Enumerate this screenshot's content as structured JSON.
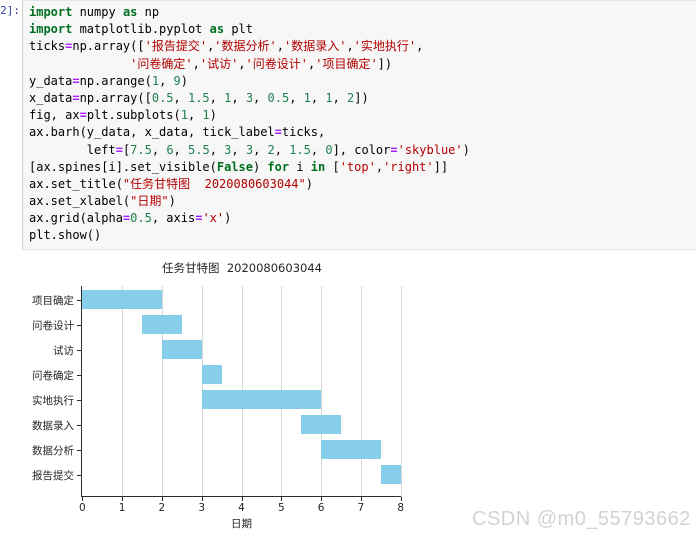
{
  "cell": {
    "prompt": "2]:",
    "code_lines": [
      [
        {
          "t": "import",
          "c": "kw"
        },
        {
          "t": " numpy ",
          "c": "plain"
        },
        {
          "t": "as",
          "c": "kw"
        },
        {
          "t": " np",
          "c": "plain"
        }
      ],
      [
        {
          "t": "import",
          "c": "kw"
        },
        {
          "t": " matplotlib.pyplot ",
          "c": "plain"
        },
        {
          "t": "as",
          "c": "kw"
        },
        {
          "t": " plt",
          "c": "plain"
        }
      ],
      [
        {
          "t": "ticks",
          "c": "plain"
        },
        {
          "t": "=",
          "c": "op"
        },
        {
          "t": "np.array([",
          "c": "plain"
        },
        {
          "t": "'报告提交'",
          "c": "str"
        },
        {
          "t": ",",
          "c": "plain"
        },
        {
          "t": "'数据分析'",
          "c": "str"
        },
        {
          "t": ",",
          "c": "plain"
        },
        {
          "t": "'数据录入'",
          "c": "str"
        },
        {
          "t": ",",
          "c": "plain"
        },
        {
          "t": "'实地执行'",
          "c": "str"
        },
        {
          "t": ",",
          "c": "plain"
        }
      ],
      [
        {
          "t": "              ",
          "c": "plain"
        },
        {
          "t": "'问卷确定'",
          "c": "str"
        },
        {
          "t": ",",
          "c": "plain"
        },
        {
          "t": "'试访'",
          "c": "str"
        },
        {
          "t": ",",
          "c": "plain"
        },
        {
          "t": "'问卷设计'",
          "c": "str"
        },
        {
          "t": ",",
          "c": "plain"
        },
        {
          "t": "'项目确定'",
          "c": "str"
        },
        {
          "t": "])",
          "c": "plain"
        }
      ],
      [
        {
          "t": "y_data",
          "c": "plain"
        },
        {
          "t": "=",
          "c": "op"
        },
        {
          "t": "np.arange(",
          "c": "plain"
        },
        {
          "t": "1",
          "c": "num"
        },
        {
          "t": ", ",
          "c": "plain"
        },
        {
          "t": "9",
          "c": "num"
        },
        {
          "t": ")",
          "c": "plain"
        }
      ],
      [
        {
          "t": "x_data",
          "c": "plain"
        },
        {
          "t": "=",
          "c": "op"
        },
        {
          "t": "np.array([",
          "c": "plain"
        },
        {
          "t": "0.5",
          "c": "num"
        },
        {
          "t": ", ",
          "c": "plain"
        },
        {
          "t": "1.5",
          "c": "num"
        },
        {
          "t": ", ",
          "c": "plain"
        },
        {
          "t": "1",
          "c": "num"
        },
        {
          "t": ", ",
          "c": "plain"
        },
        {
          "t": "3",
          "c": "num"
        },
        {
          "t": ", ",
          "c": "plain"
        },
        {
          "t": "0.5",
          "c": "num"
        },
        {
          "t": ", ",
          "c": "plain"
        },
        {
          "t": "1",
          "c": "num"
        },
        {
          "t": ", ",
          "c": "plain"
        },
        {
          "t": "1",
          "c": "num"
        },
        {
          "t": ", ",
          "c": "plain"
        },
        {
          "t": "2",
          "c": "num"
        },
        {
          "t": "])",
          "c": "plain"
        }
      ],
      [
        {
          "t": "fig, ax",
          "c": "plain"
        },
        {
          "t": "=",
          "c": "op"
        },
        {
          "t": "plt.subplots(",
          "c": "plain"
        },
        {
          "t": "1",
          "c": "num"
        },
        {
          "t": ", ",
          "c": "plain"
        },
        {
          "t": "1",
          "c": "num"
        },
        {
          "t": ")",
          "c": "plain"
        }
      ],
      [
        {
          "t": "ax.barh(y_data, x_data, tick_label",
          "c": "plain"
        },
        {
          "t": "=",
          "c": "op"
        },
        {
          "t": "ticks,",
          "c": "plain"
        }
      ],
      [
        {
          "t": "        left",
          "c": "plain"
        },
        {
          "t": "=",
          "c": "op"
        },
        {
          "t": "[",
          "c": "plain"
        },
        {
          "t": "7.5",
          "c": "num"
        },
        {
          "t": ", ",
          "c": "plain"
        },
        {
          "t": "6",
          "c": "num"
        },
        {
          "t": ", ",
          "c": "plain"
        },
        {
          "t": "5.5",
          "c": "num"
        },
        {
          "t": ", ",
          "c": "plain"
        },
        {
          "t": "3",
          "c": "num"
        },
        {
          "t": ", ",
          "c": "plain"
        },
        {
          "t": "3",
          "c": "num"
        },
        {
          "t": ", ",
          "c": "plain"
        },
        {
          "t": "2",
          "c": "num"
        },
        {
          "t": ", ",
          "c": "plain"
        },
        {
          "t": "1.5",
          "c": "num"
        },
        {
          "t": ", ",
          "c": "plain"
        },
        {
          "t": "0",
          "c": "num"
        },
        {
          "t": "], color",
          "c": "plain"
        },
        {
          "t": "=",
          "c": "op"
        },
        {
          "t": "'skyblue'",
          "c": "str"
        },
        {
          "t": ")",
          "c": "plain"
        }
      ],
      [
        {
          "t": "[ax.spines[i].set_visible(",
          "c": "plain"
        },
        {
          "t": "False",
          "c": "bkw"
        },
        {
          "t": ") ",
          "c": "plain"
        },
        {
          "t": "for",
          "c": "kw"
        },
        {
          "t": " i ",
          "c": "plain"
        },
        {
          "t": "in",
          "c": "kw"
        },
        {
          "t": " [",
          "c": "plain"
        },
        {
          "t": "'top'",
          "c": "str"
        },
        {
          "t": ",",
          "c": "plain"
        },
        {
          "t": "'right'",
          "c": "str"
        },
        {
          "t": "]]",
          "c": "plain"
        }
      ],
      [
        {
          "t": "ax.set_title(",
          "c": "plain"
        },
        {
          "t": "\"任务甘特图  2020080603044\"",
          "c": "str"
        },
        {
          "t": ")",
          "c": "plain"
        }
      ],
      [
        {
          "t": "ax.set_xlabel(",
          "c": "plain"
        },
        {
          "t": "\"日期\"",
          "c": "str"
        },
        {
          "t": ")",
          "c": "plain"
        }
      ],
      [
        {
          "t": "ax.grid(alpha",
          "c": "plain"
        },
        {
          "t": "=",
          "c": "op"
        },
        {
          "t": "0.5",
          "c": "num"
        },
        {
          "t": ", axis",
          "c": "plain"
        },
        {
          "t": "=",
          "c": "op"
        },
        {
          "t": "'x'",
          "c": "str"
        },
        {
          "t": ")",
          "c": "plain"
        }
      ],
      [
        {
          "t": "plt.show()",
          "c": "plain"
        }
      ]
    ]
  },
  "chart_data": {
    "type": "bar",
    "orientation": "horizontal",
    "title": "任务甘特图  2020080603044",
    "xlabel": "日期",
    "ylabel": "",
    "xlim": [
      0,
      8.2
    ],
    "xticks": [
      0,
      1,
      2,
      3,
      4,
      5,
      6,
      7,
      8
    ],
    "xticklabels": [
      "0",
      "1",
      "2",
      "3",
      "4",
      "5",
      "6",
      "7",
      "8"
    ],
    "grid": "x",
    "grid_alpha": 0.5,
    "bar_color": "#87ceeb",
    "legend": null,
    "categories": [
      "项目确定",
      "问卷设计",
      "试访",
      "问卷确定",
      "实地执行",
      "数据录入",
      "数据分析",
      "报告提交"
    ],
    "left": [
      0,
      1.5,
      2,
      3,
      3,
      5.5,
      6,
      7.5
    ],
    "width": [
      2,
      1,
      1,
      0.5,
      3,
      1,
      1.5,
      0.5
    ],
    "bars": [
      {
        "label": "项目确定",
        "start": 0,
        "duration": 2,
        "end": 2
      },
      {
        "label": "问卷设计",
        "start": 1.5,
        "duration": 1,
        "end": 2.5
      },
      {
        "label": "试访",
        "start": 2,
        "duration": 1,
        "end": 3
      },
      {
        "label": "问卷确定",
        "start": 3,
        "duration": 0.5,
        "end": 3.5
      },
      {
        "label": "实地执行",
        "start": 3,
        "duration": 3,
        "end": 6
      },
      {
        "label": "数据录入",
        "start": 5.5,
        "duration": 1,
        "end": 6.5
      },
      {
        "label": "数据分析",
        "start": 6,
        "duration": 1.5,
        "end": 7.5
      },
      {
        "label": "报告提交",
        "start": 7.5,
        "duration": 0.5,
        "end": 8
      }
    ]
  },
  "watermark": {
    "text": "CSDN @m0_55793662"
  }
}
